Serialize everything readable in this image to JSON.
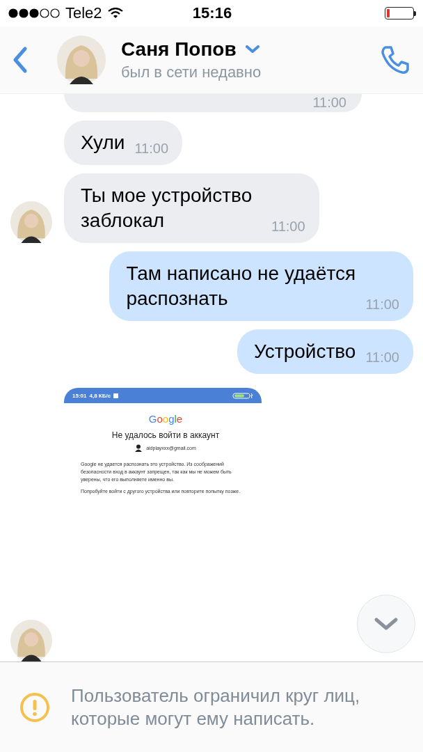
{
  "status_bar": {
    "carrier": "Tele2",
    "time": "15:16"
  },
  "header": {
    "name": "Саня Попов",
    "status": "был в сети недавно"
  },
  "messages": [
    {
      "kind": "in",
      "time": "11:00",
      "avatar": false,
      "cut": true
    },
    {
      "kind": "in",
      "text": "Хули",
      "time": "11:00",
      "avatar": false,
      "cut": false
    },
    {
      "kind": "in",
      "text": "Ты мое устройство заблокал",
      "time": "11:00",
      "avatar": true,
      "cut": false
    },
    {
      "kind": "out",
      "text": "Там написано не удаётся распознать",
      "time": "11:00"
    },
    {
      "kind": "out",
      "text": "Устройство",
      "time": "11:00"
    },
    {
      "kind": "screenshot",
      "avatar": true,
      "shot": {
        "time": "15:01",
        "speed": "4,8 КБ/с",
        "logo": "Google",
        "title": "Не удалось войти в аккаунт",
        "email": "aidplayxxx@gmail.com",
        "paragraphs": [
          "Google не удается распознать это устройство. Из соображений безопасности вход в аккаунт запрещен, так как мы не можем быть уверены, что его выполняете именно вы.",
          "Попробуйте войти с другого устройства или повторите попытку позже."
        ]
      }
    }
  ],
  "notice": "Пользователь ограничил круг лиц, которые могут ему написать."
}
